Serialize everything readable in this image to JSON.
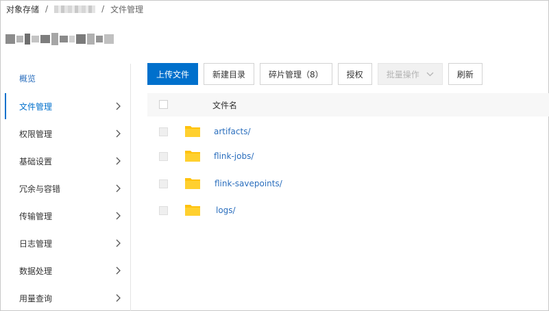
{
  "breadcrumb": {
    "root": "对象存储",
    "separator": "/",
    "current": "文件管理"
  },
  "sidebar": {
    "items": [
      {
        "label": "概览",
        "has_chevron": false
      },
      {
        "label": "文件管理",
        "has_chevron": true
      },
      {
        "label": "权限管理",
        "has_chevron": true
      },
      {
        "label": "基础设置",
        "has_chevron": true
      },
      {
        "label": "冗余与容错",
        "has_chevron": true
      },
      {
        "label": "传输管理",
        "has_chevron": true
      },
      {
        "label": "日志管理",
        "has_chevron": true
      },
      {
        "label": "数据处理",
        "has_chevron": true
      },
      {
        "label": "用量查询",
        "has_chevron": true
      }
    ],
    "active_index": 1
  },
  "toolbar": {
    "upload_label": "上传文件",
    "new_dir_label": "新建目录",
    "fragments_label": "碎片管理（8）",
    "authorize_label": "授权",
    "batch_label": "批量操作",
    "refresh_label": "刷新"
  },
  "table": {
    "name_header": "文件名",
    "rows": [
      {
        "name": "artifacts/",
        "icon": "folder-icon"
      },
      {
        "name": "flink-jobs/",
        "icon": "folder-icon"
      },
      {
        "name": "flink-savepoints/",
        "icon": "folder-icon"
      },
      {
        "name": "logs/",
        "icon": "folder-icon"
      }
    ]
  },
  "colors": {
    "primary": "#0070cc",
    "link": "#2a6ebd",
    "folder": "#ffc20e"
  }
}
